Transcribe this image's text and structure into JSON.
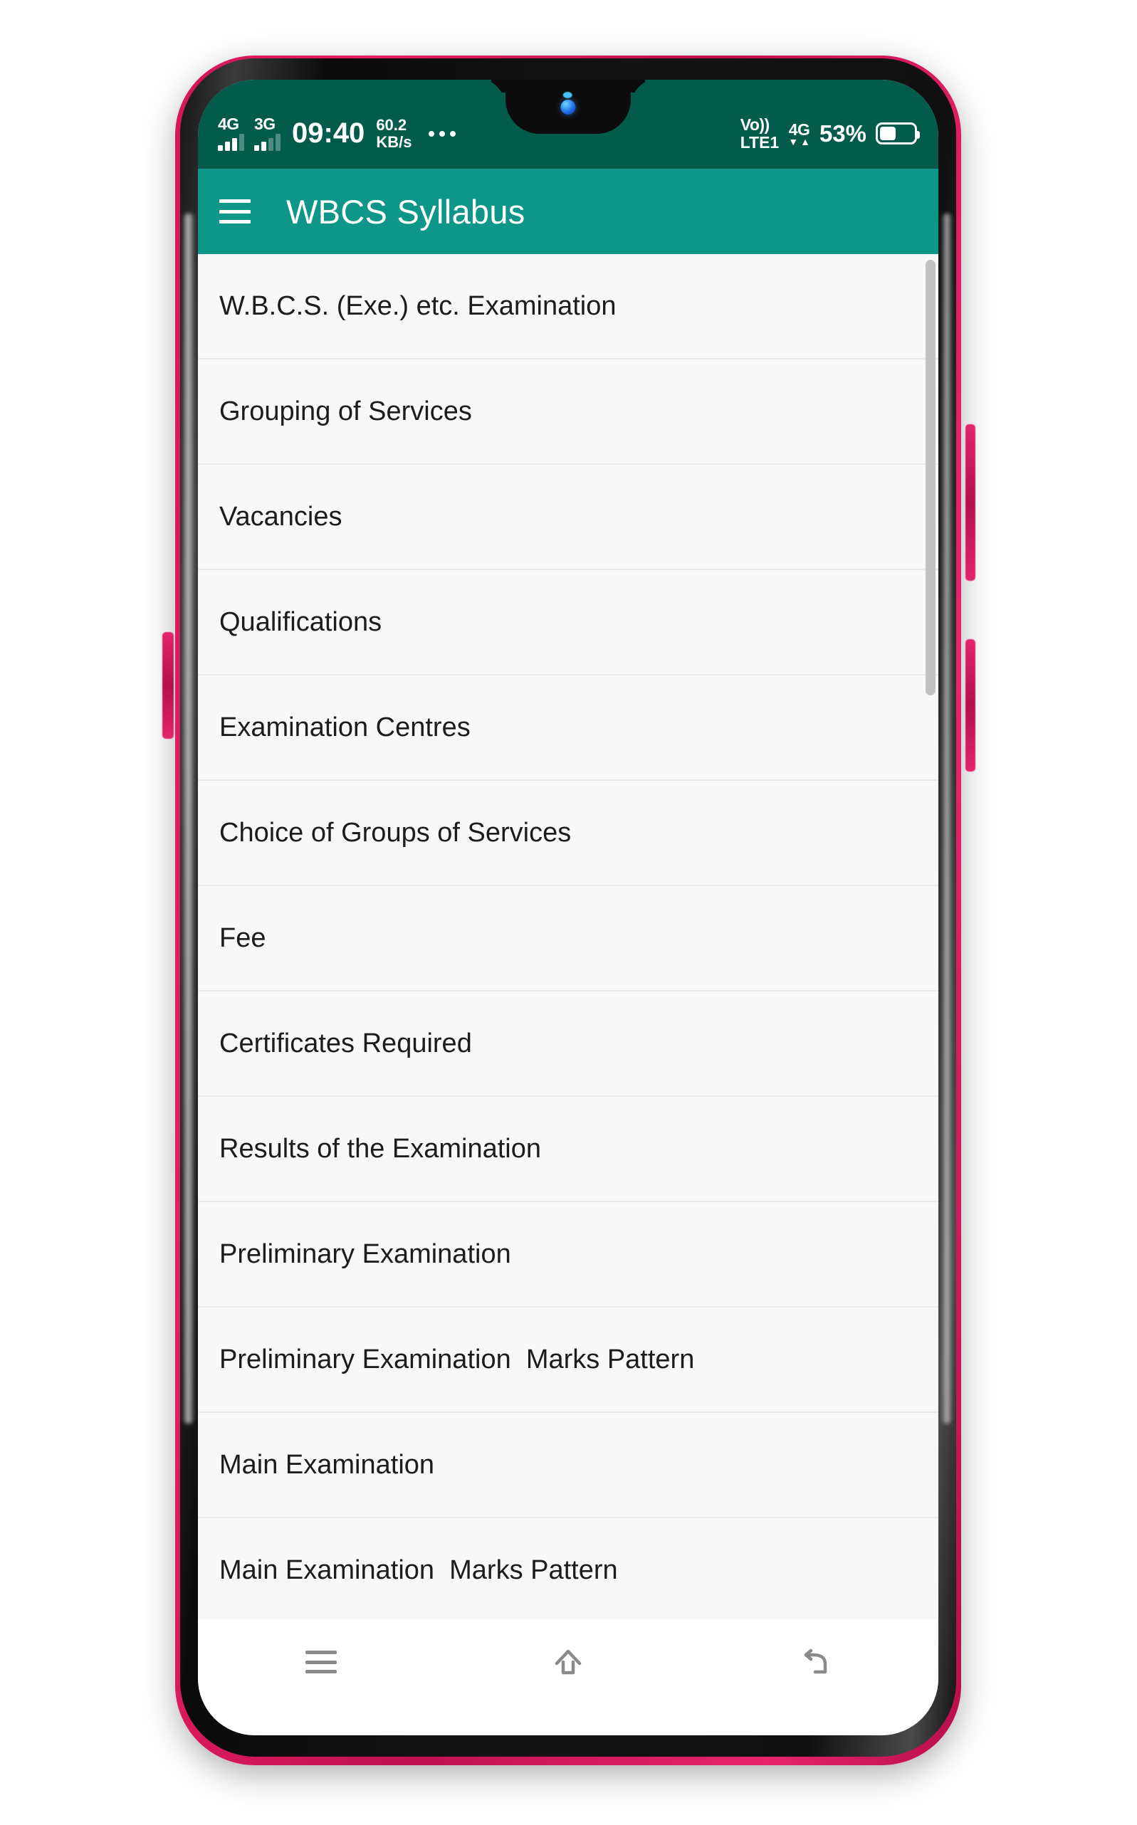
{
  "status_bar": {
    "network_1": {
      "label": "4G",
      "bars_active": 3,
      "bars_total": 4
    },
    "network_2": {
      "label": "3G",
      "bars_active": 2,
      "bars_total": 4
    },
    "time": "09:40",
    "net_speed_value": "60.2",
    "net_speed_unit": "KB/s",
    "overflow_icon": "more-dots-icon",
    "volte_top": "Vo))",
    "volte_bottom": "LTE1",
    "data_network": "4G",
    "data_arrow_down": "▼",
    "data_arrow_up": "▲",
    "battery_percent": "53%",
    "battery_level": 53,
    "battery_icon": "battery-icon"
  },
  "app_bar": {
    "menu_icon": "hamburger-menu-icon",
    "title": "WBCS Syllabus",
    "background_color": "#0e9688"
  },
  "list": {
    "scrollbar_visible": true,
    "items": [
      {
        "label": "W.B.C.S. (Exe.) etc. Examination"
      },
      {
        "label": "Grouping of Services"
      },
      {
        "label": "Vacancies"
      },
      {
        "label": "Qualifications"
      },
      {
        "label": "Examination Centres"
      },
      {
        "label": "Choice of Groups of Services"
      },
      {
        "label": "Fee"
      },
      {
        "label": "Certificates Required"
      },
      {
        "label": "Results of the Examination"
      },
      {
        "label": "Preliminary Examination"
      },
      {
        "label": "Preliminary Examination  Marks Pattern"
      },
      {
        "label": "Main Examination"
      },
      {
        "label": "Main Examination  Marks Pattern"
      }
    ]
  },
  "nav_bar": {
    "recents_icon": "recents-menu-icon",
    "home_icon": "home-icon",
    "back_icon": "back-icon"
  },
  "theme": {
    "status_bar_color": "#035b4c",
    "app_bar_color": "#0e9688",
    "list_background": "#f8f8f8",
    "divider_color": "#eaeaea",
    "phone_accent": "#e31e63"
  }
}
